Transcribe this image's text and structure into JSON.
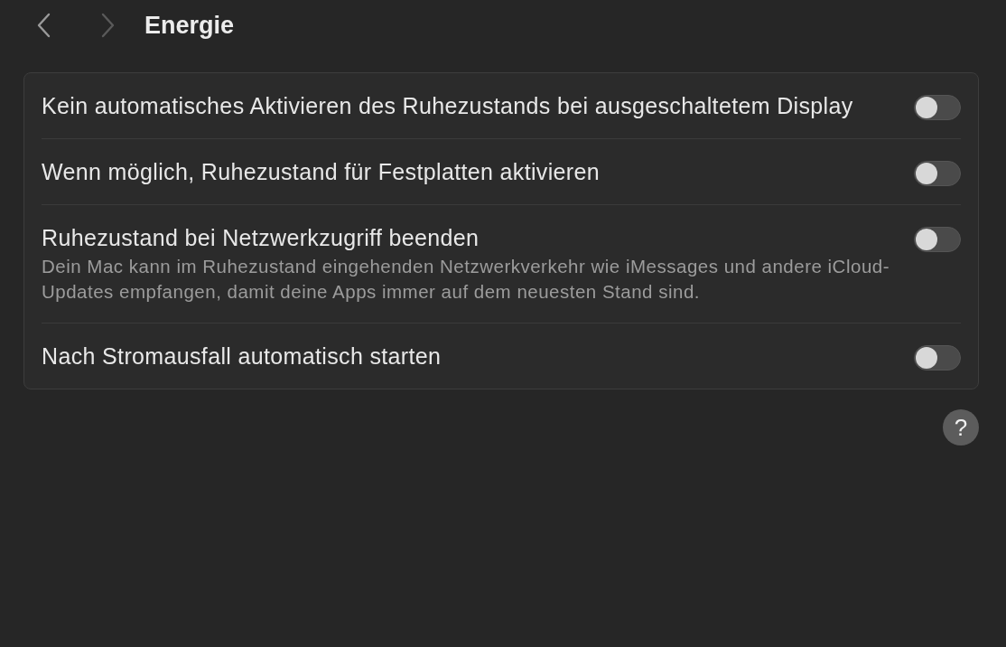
{
  "nav": [
    {
      "kind": "back",
      "disabled": false
    },
    {
      "kind": "forward",
      "disabled": true
    }
  ],
  "title": "Energie",
  "settings": [
    {
      "title": "Kein automatisches Aktivieren des Ruhezustands bei ausgeschaltetem Display",
      "on": false
    },
    {
      "title": "Wenn möglich, Ruhezustand für Festplatten aktivieren",
      "on": false
    },
    {
      "title": "Ruhezustand bei Netzwerkzugriff beenden",
      "description": "Dein Mac kann im Ruhezustand eingehenden Netzwerkverkehr wie iMessages und andere iCloud-Updates empfangen, damit deine Apps immer auf dem neuesten Stand sind.",
      "on": false
    },
    {
      "title": "Nach Stromausfall automatisch starten",
      "on": false
    }
  ],
  "help": {
    "label": "?"
  }
}
